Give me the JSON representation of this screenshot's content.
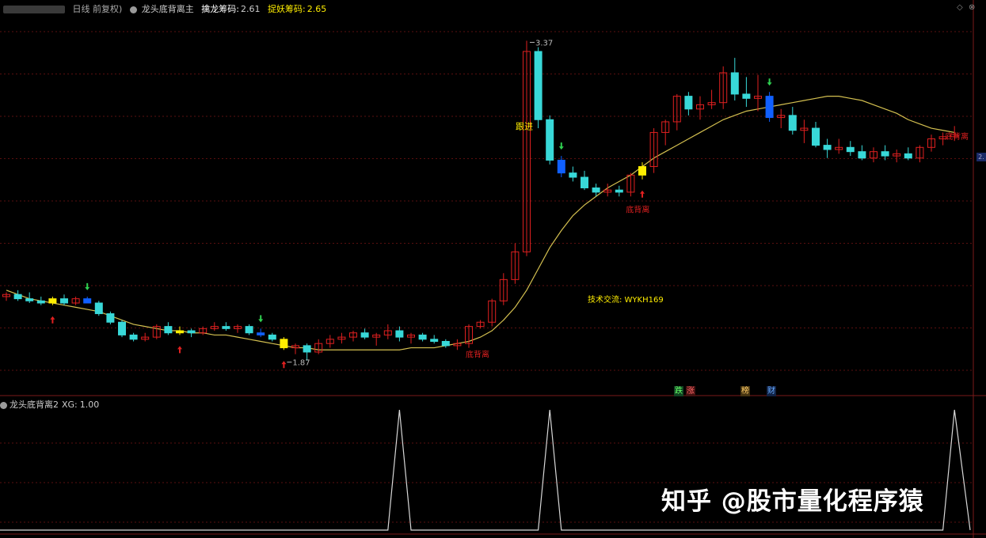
{
  "header": {
    "period": "日线 前复权)",
    "indicator_name": "龙头底背离主",
    "label1": "擒龙筹码:",
    "value1": "2.61",
    "label2": "捉妖筹码:",
    "value2": "2.65"
  },
  "subchart": {
    "indicator_name": "龙头底背离2",
    "label": "XG:",
    "value": "1.00"
  },
  "toolbar": {
    "menu_icon": "diamond-icon",
    "close_icon": "close-icon"
  },
  "annotations": {
    "high_value": "3.37",
    "low_value": "1.87",
    "follow_label": "跟进",
    "divergence_label": "底背离",
    "contact_label": "技术交流: WYKH169"
  },
  "badges": [
    "跌",
    "涨",
    "榜",
    "财"
  ],
  "axis_badge": "2.",
  "watermark": "知乎 @股市量化程序猿",
  "colors": {
    "up": "#e02020",
    "down": "#38d8d8",
    "ma": "#d4c050",
    "yellow": "#ffee00",
    "blue": "#1060ff",
    "green": "#2fd050",
    "grid": "#5a0f0f",
    "signal": "#d8d8d8"
  },
  "chart_data": {
    "type": "candlestick",
    "candles": [
      [
        2.17,
        2.19,
        2.15,
        2.18
      ],
      [
        2.18,
        2.2,
        2.15,
        2.16
      ],
      [
        2.16,
        2.19,
        2.14,
        2.15
      ],
      [
        2.15,
        2.17,
        2.13,
        2.14
      ],
      [
        2.14,
        2.17,
        2.13,
        2.16
      ],
      [
        2.16,
        2.18,
        2.13,
        2.14
      ],
      [
        2.14,
        2.17,
        2.13,
        2.16
      ],
      [
        2.16,
        2.17,
        2.14,
        2.14
      ],
      [
        2.14,
        2.15,
        2.08,
        2.09
      ],
      [
        2.09,
        2.1,
        2.04,
        2.05
      ],
      [
        2.05,
        2.06,
        1.98,
        1.99
      ],
      [
        1.99,
        2.0,
        1.96,
        1.97
      ],
      [
        1.97,
        2.0,
        1.96,
        1.98
      ],
      [
        1.98,
        2.04,
        1.97,
        2.03
      ],
      [
        2.03,
        2.05,
        1.99,
        2.0
      ],
      [
        2.0,
        2.03,
        1.99,
        2.01
      ],
      [
        2.01,
        2.02,
        1.98,
        2.0
      ],
      [
        2.0,
        2.03,
        1.99,
        2.02
      ],
      [
        2.02,
        2.05,
        2.01,
        2.03
      ],
      [
        2.03,
        2.05,
        2.01,
        2.02
      ],
      [
        2.02,
        2.04,
        2.0,
        2.03
      ],
      [
        2.03,
        2.04,
        1.99,
        2.0
      ],
      [
        2.0,
        2.02,
        1.98,
        1.99
      ],
      [
        1.99,
        2.0,
        1.96,
        1.97
      ],
      [
        1.97,
        1.98,
        1.92,
        1.93
      ],
      [
        1.93,
        1.95,
        1.9,
        1.94
      ],
      [
        1.94,
        1.95,
        1.87,
        1.91
      ],
      [
        1.91,
        1.97,
        1.9,
        1.95
      ],
      [
        1.95,
        1.99,
        1.93,
        1.97
      ],
      [
        1.97,
        2.0,
        1.95,
        1.98
      ],
      [
        1.98,
        2.01,
        1.96,
        2.0
      ],
      [
        2.0,
        2.02,
        1.97,
        1.98
      ],
      [
        1.98,
        2.0,
        1.94,
        1.99
      ],
      [
        1.99,
        2.04,
        1.97,
        2.01
      ],
      [
        2.01,
        2.03,
        1.96,
        1.98
      ],
      [
        1.98,
        2.0,
        1.95,
        1.99
      ],
      [
        1.99,
        2.0,
        1.96,
        1.97
      ],
      [
        1.97,
        1.99,
        1.95,
        1.96
      ],
      [
        1.96,
        1.97,
        1.93,
        1.94
      ],
      [
        1.94,
        1.97,
        1.92,
        1.95
      ],
      [
        1.95,
        2.04,
        1.93,
        2.03
      ],
      [
        2.03,
        2.06,
        2.02,
        2.05
      ],
      [
        2.05,
        2.16,
        2.03,
        2.15
      ],
      [
        2.15,
        2.28,
        2.13,
        2.25
      ],
      [
        2.25,
        2.42,
        2.23,
        2.38
      ],
      [
        2.38,
        3.37,
        2.36,
        3.32
      ],
      [
        3.32,
        3.34,
        2.96,
        3.0
      ],
      [
        3.0,
        3.02,
        2.79,
        2.81
      ],
      [
        2.81,
        2.83,
        2.73,
        2.75
      ],
      [
        2.75,
        2.78,
        2.71,
        2.73
      ],
      [
        2.73,
        2.76,
        2.67,
        2.68
      ],
      [
        2.68,
        2.7,
        2.64,
        2.66
      ],
      [
        2.66,
        2.7,
        2.64,
        2.67
      ],
      [
        2.67,
        2.69,
        2.64,
        2.66
      ],
      [
        2.66,
        2.75,
        2.64,
        2.74
      ],
      [
        2.74,
        2.8,
        2.72,
        2.78
      ],
      [
        2.78,
        2.96,
        2.75,
        2.94
      ],
      [
        2.94,
        3.0,
        2.88,
        2.99
      ],
      [
        2.99,
        3.12,
        2.95,
        3.11
      ],
      [
        3.11,
        3.13,
        3.02,
        3.05
      ],
      [
        3.05,
        3.11,
        3.0,
        3.07
      ],
      [
        3.07,
        3.14,
        3.05,
        3.08
      ],
      [
        3.08,
        3.25,
        3.05,
        3.22
      ],
      [
        3.22,
        3.29,
        3.09,
        3.12
      ],
      [
        3.12,
        3.2,
        3.06,
        3.1
      ],
      [
        3.1,
        3.21,
        3.04,
        3.11
      ],
      [
        3.11,
        3.13,
        2.99,
        3.01
      ],
      [
        3.01,
        3.05,
        2.96,
        3.02
      ],
      [
        3.02,
        3.06,
        2.93,
        2.95
      ],
      [
        2.95,
        3.0,
        2.89,
        2.96
      ],
      [
        2.96,
        2.99,
        2.87,
        2.88
      ],
      [
        2.88,
        2.91,
        2.82,
        2.86
      ],
      [
        2.86,
        2.91,
        2.84,
        2.87
      ],
      [
        2.87,
        2.9,
        2.83,
        2.85
      ],
      [
        2.85,
        2.88,
        2.81,
        2.82
      ],
      [
        2.82,
        2.87,
        2.8,
        2.85
      ],
      [
        2.85,
        2.88,
        2.81,
        2.83
      ],
      [
        2.83,
        2.86,
        2.8,
        2.84
      ],
      [
        2.84,
        2.87,
        2.81,
        2.82
      ],
      [
        2.82,
        2.88,
        2.8,
        2.87
      ],
      [
        2.87,
        2.93,
        2.85,
        2.91
      ],
      [
        2.91,
        2.94,
        2.88,
        2.92
      ],
      [
        2.92,
        2.97,
        2.9,
        2.93
      ]
    ],
    "ma": [
      2.2,
      2.18,
      2.16,
      2.15,
      2.14,
      2.13,
      2.12,
      2.11,
      2.1,
      2.08,
      2.06,
      2.04,
      2.03,
      2.02,
      2.01,
      2.01,
      2.0,
      2.0,
      1.99,
      1.99,
      1.98,
      1.97,
      1.96,
      1.95,
      1.94,
      1.93,
      1.93,
      1.92,
      1.92,
      1.92,
      1.92,
      1.92,
      1.92,
      1.92,
      1.92,
      1.93,
      1.93,
      1.93,
      1.94,
      1.95,
      1.96,
      1.98,
      2.01,
      2.06,
      2.12,
      2.2,
      2.3,
      2.4,
      2.48,
      2.55,
      2.6,
      2.64,
      2.68,
      2.71,
      2.74,
      2.78,
      2.82,
      2.85,
      2.88,
      2.91,
      2.94,
      2.97,
      3.0,
      3.02,
      3.04,
      3.05,
      3.06,
      3.07,
      3.08,
      3.09,
      3.1,
      3.11,
      3.11,
      3.1,
      3.09,
      3.07,
      3.05,
      3.03,
      3.0,
      2.98,
      2.96,
      2.95,
      2.94
    ],
    "signal_pulses": [
      34,
      47,
      82
    ],
    "ylim": [
      1.78,
      3.45
    ]
  }
}
